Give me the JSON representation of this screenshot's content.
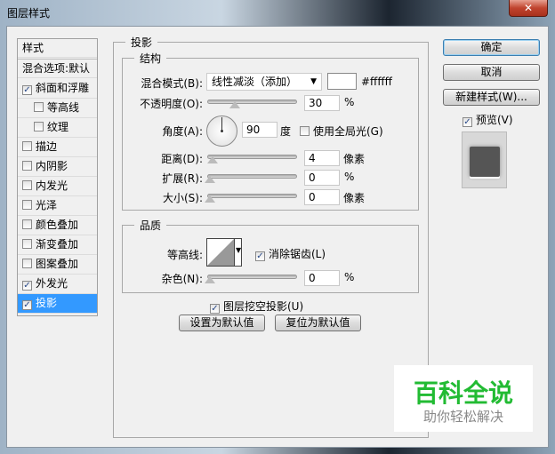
{
  "window": {
    "title": "图层样式",
    "close": "✕"
  },
  "sidebar": {
    "header": "样式",
    "blend_options": "混合选项:默认",
    "items": [
      {
        "label": "斜面和浮雕",
        "checked": true,
        "indent": false
      },
      {
        "label": "等高线",
        "checked": false,
        "indent": true
      },
      {
        "label": "纹理",
        "checked": false,
        "indent": true
      },
      {
        "label": "描边",
        "checked": false,
        "indent": false
      },
      {
        "label": "内阴影",
        "checked": false,
        "indent": false
      },
      {
        "label": "内发光",
        "checked": false,
        "indent": false
      },
      {
        "label": "光泽",
        "checked": false,
        "indent": false
      },
      {
        "label": "颜色叠加",
        "checked": false,
        "indent": false
      },
      {
        "label": "渐变叠加",
        "checked": false,
        "indent": false
      },
      {
        "label": "图案叠加",
        "checked": false,
        "indent": false
      },
      {
        "label": "外发光",
        "checked": true,
        "indent": false
      },
      {
        "label": "投影",
        "checked": true,
        "indent": false,
        "selected": true
      }
    ]
  },
  "panel": {
    "title": "投影",
    "structure": {
      "title": "结构",
      "blend_mode_label": "混合模式(B):",
      "blend_mode": "线性减淡（添加）",
      "color": "#ffffff",
      "color_text": "#ffffff",
      "opacity_label": "不透明度(O):",
      "opacity": "30",
      "opacity_unit": "%",
      "angle_label": "角度(A):",
      "angle": "90",
      "angle_unit": "度",
      "global_light": "使用全局光(G)",
      "global_light_checked": false,
      "distance_label": "距离(D):",
      "distance": "4",
      "distance_unit": "像素",
      "spread_label": "扩展(R):",
      "spread": "0",
      "spread_unit": "%",
      "size_label": "大小(S):",
      "size": "0",
      "size_unit": "像素"
    },
    "quality": {
      "title": "品质",
      "contour_label": "等高线:",
      "antialias": "消除锯齿(L)",
      "antialias_checked": true,
      "noise_label": "杂色(N):",
      "noise": "0",
      "noise_unit": "%"
    },
    "knockout": "图层挖空投影(U)",
    "knockout_checked": true,
    "set_default": "设置为默认值",
    "reset_default": "复位为默认值"
  },
  "buttons": {
    "ok": "确定",
    "cancel": "取消",
    "new_style": "新建样式(W)...",
    "preview": "预览(V)",
    "preview_checked": true
  },
  "watermark": {
    "title": "百科全说",
    "subtitle": "助你轻松解决"
  }
}
